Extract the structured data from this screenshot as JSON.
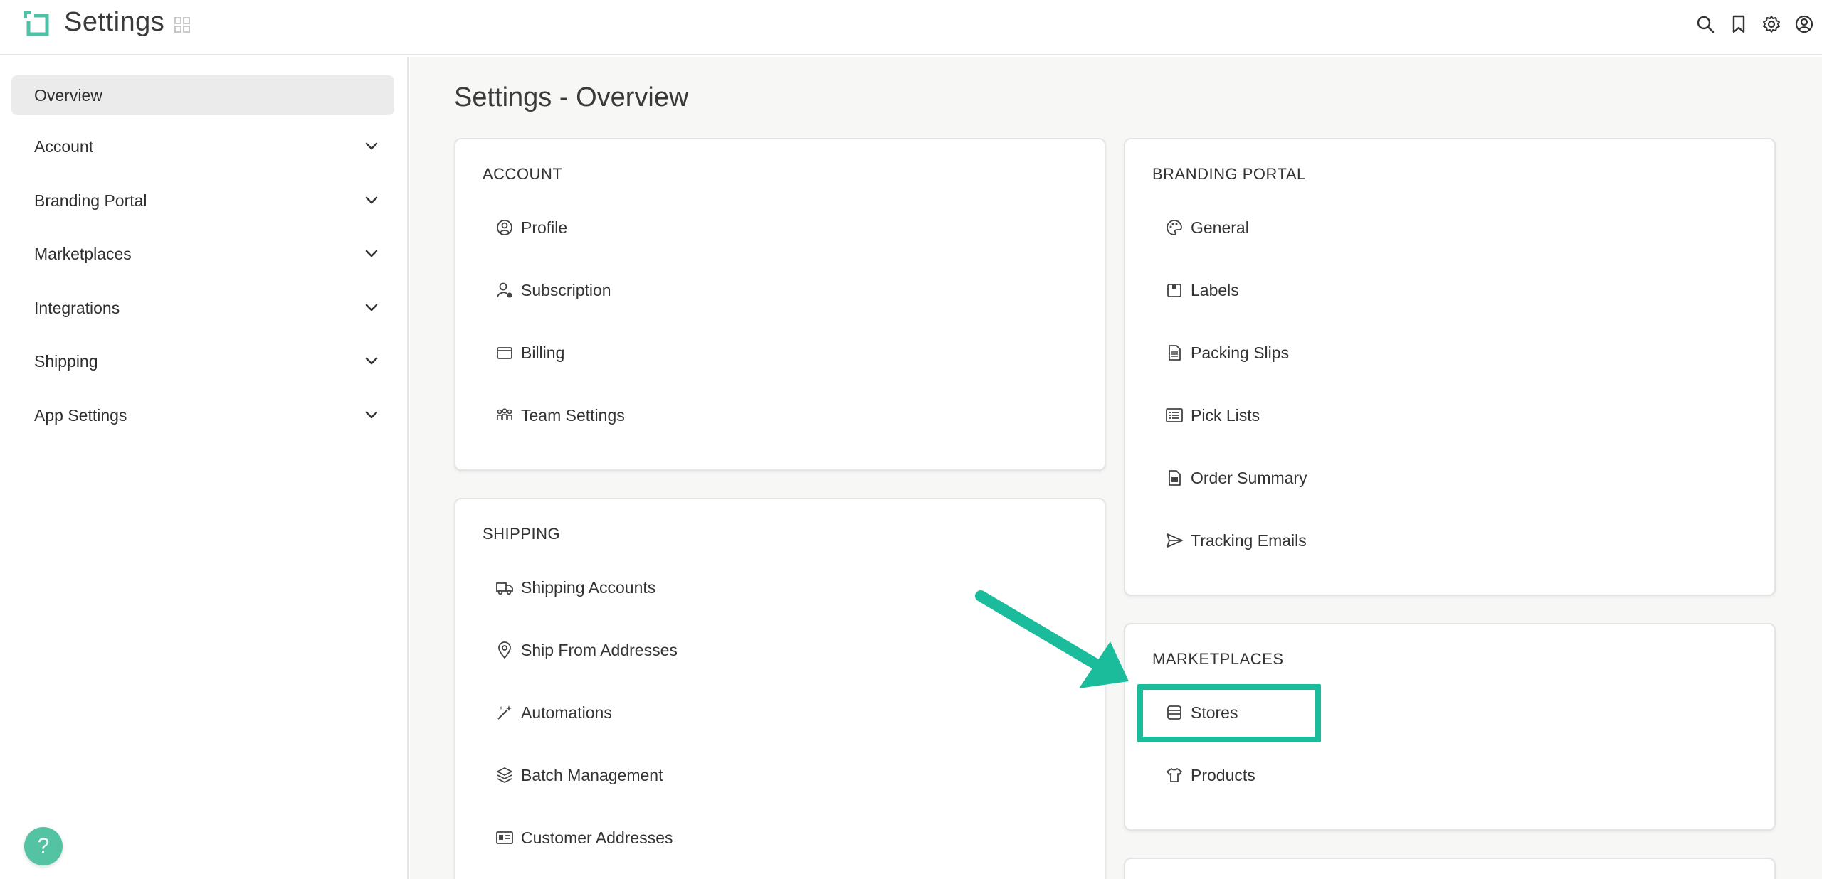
{
  "app": {
    "title": "Settings"
  },
  "colors": {
    "accent": "#1bbc9b",
    "help_button": "#53c3a3",
    "logo": "#4fc1a7"
  },
  "topbar_icons": [
    "search-icon",
    "bookmark-icon",
    "gear-icon",
    "user-circle-icon"
  ],
  "sidebar": {
    "items": [
      {
        "label": "Overview",
        "active": true
      },
      {
        "label": "Account",
        "expandable": true
      },
      {
        "label": "Branding Portal",
        "expandable": true
      },
      {
        "label": "Marketplaces",
        "expandable": true
      },
      {
        "label": "Integrations",
        "expandable": true
      },
      {
        "label": "Shipping",
        "expandable": true
      },
      {
        "label": "App Settings",
        "expandable": true
      }
    ],
    "help_label": "?"
  },
  "main": {
    "title": "Settings - Overview",
    "cards": {
      "account": {
        "title": "ACCOUNT",
        "items": [
          "Profile",
          "Subscription",
          "Billing",
          "Team Settings"
        ]
      },
      "shipping": {
        "title": "SHIPPING",
        "items": [
          "Shipping Accounts",
          "Ship From Addresses",
          "Automations",
          "Batch Management",
          "Customer Addresses"
        ]
      },
      "branding": {
        "title": "BRANDING PORTAL",
        "items": [
          "General",
          "Labels",
          "Packing Slips",
          "Pick Lists",
          "Order Summary",
          "Tracking Emails"
        ]
      },
      "marketplaces": {
        "title": "MARKETPLACES",
        "items": [
          "Stores",
          "Products"
        ]
      }
    }
  }
}
